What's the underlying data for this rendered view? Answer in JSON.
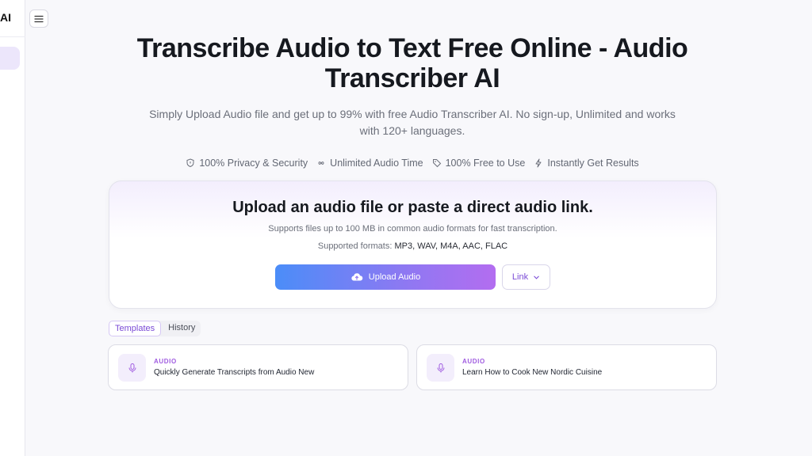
{
  "sidebar": {
    "brand": "AI"
  },
  "hero": {
    "title": "Transcribe Audio to Text Free Online - Audio Transcriber AI",
    "subtitle": "Simply Upload Audio file and get up to 99% with free Audio Transcriber AI. No sign-up, Unlimited and works with 120+ languages."
  },
  "features": [
    {
      "icon": "shield-icon",
      "label": "100% Privacy & Security"
    },
    {
      "icon": "infinity-icon",
      "label": "Unlimited Audio Time"
    },
    {
      "icon": "tag-icon",
      "label": "100% Free to Use"
    },
    {
      "icon": "lightning-icon",
      "label": "Instantly Get Results"
    }
  ],
  "upload": {
    "title": "Upload an audio file or paste a direct audio link.",
    "description": "Supports files up to 100 MB in common audio formats for fast transcription.",
    "formats_label": "Supported formats:",
    "formats_value": "MP3, WAV, M4A, AAC, FLAC",
    "upload_button": "Upload Audio",
    "link_button": "Link"
  },
  "tabs": [
    {
      "label": "Templates",
      "active": true
    },
    {
      "label": "History",
      "active": false
    }
  ],
  "templates": [
    {
      "tag": "AUDIO",
      "name": "Quickly Generate Transcripts from Audio New"
    },
    {
      "tag": "AUDIO",
      "name": "Learn How to Cook New Nordic Cuisine"
    }
  ],
  "colors": {
    "accent": "#7a4ad6",
    "gradient_start": "#4b8df8",
    "gradient_end": "#b36df0",
    "background": "#f8f8fb"
  }
}
